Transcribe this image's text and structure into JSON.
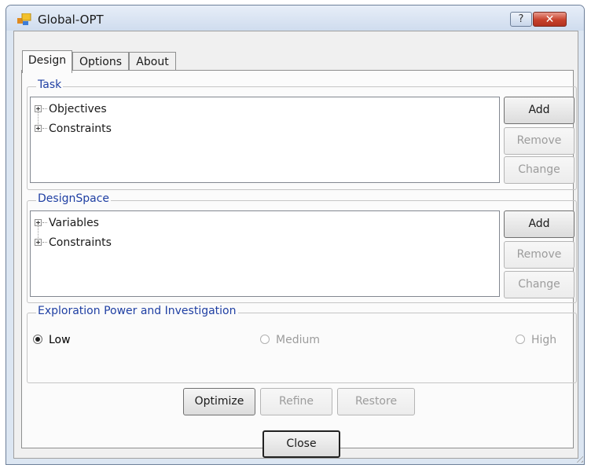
{
  "window": {
    "title": "Global-OPT",
    "help_label": "?",
    "close_glyph": "✕"
  },
  "tabs": [
    {
      "label": "Design"
    },
    {
      "label": "Options"
    },
    {
      "label": "About"
    }
  ],
  "task": {
    "label": "Task",
    "items": [
      "Objectives",
      "Constraints"
    ],
    "add": "Add",
    "remove": "Remove",
    "change": "Change"
  },
  "design_space": {
    "label": "DesignSpace",
    "items": [
      "Variables",
      "Constraints"
    ],
    "add": "Add",
    "remove": "Remove",
    "change": "Change"
  },
  "exploration": {
    "label": "Exploration Power and Investigation",
    "options": [
      {
        "label": "Low",
        "checked": true,
        "enabled": true
      },
      {
        "label": "Medium",
        "checked": false,
        "enabled": false
      },
      {
        "label": "High",
        "checked": false,
        "enabled": false
      }
    ]
  },
  "actions": {
    "optimize": "Optimize",
    "refine": "Refine",
    "restore": "Restore"
  },
  "footer": {
    "close": "Close"
  },
  "icons": {
    "app": "app-window-icon",
    "expander": "plus-box-icon",
    "resize": "resize-grip-icon"
  },
  "colors": {
    "group_label": "#1f3fa3",
    "close_button": "#c7412c",
    "disabled_text": "#9c9c9c"
  }
}
